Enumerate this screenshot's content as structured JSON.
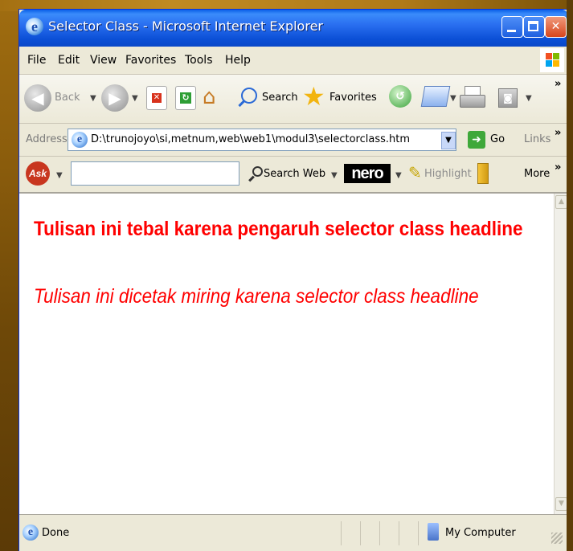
{
  "window": {
    "title": "Selector Class - Microsoft Internet Explorer"
  },
  "menu": {
    "items": [
      "File",
      "Edit",
      "View",
      "Favorites",
      "Tools",
      "Help"
    ]
  },
  "toolbar": {
    "back_label": "Back",
    "search_label": "Search",
    "favorites_label": "Favorites"
  },
  "address": {
    "label": "Address",
    "url": "D:\\trunojoyo\\si,metnum,web\\web1\\modul3\\selectorclass.htm",
    "go_label": "Go",
    "links_label": "Links"
  },
  "ask_toolbar": {
    "logo_text": "Ask",
    "search_web_label": "Search Web",
    "nero_label": "nero",
    "highlight_label": "Highlight",
    "more_label": "More"
  },
  "page": {
    "headline": "Tulisan ini tebal karena pengaruh selector class headline",
    "italic_line": "Tulisan ini dicetak miring karena selector class headline"
  },
  "status": {
    "text": "Done",
    "zone": "My Computer"
  },
  "colors": {
    "title_bar": "#2a6ff0",
    "page_text": "#ff0000",
    "desktop_bg": "#7a5208"
  }
}
